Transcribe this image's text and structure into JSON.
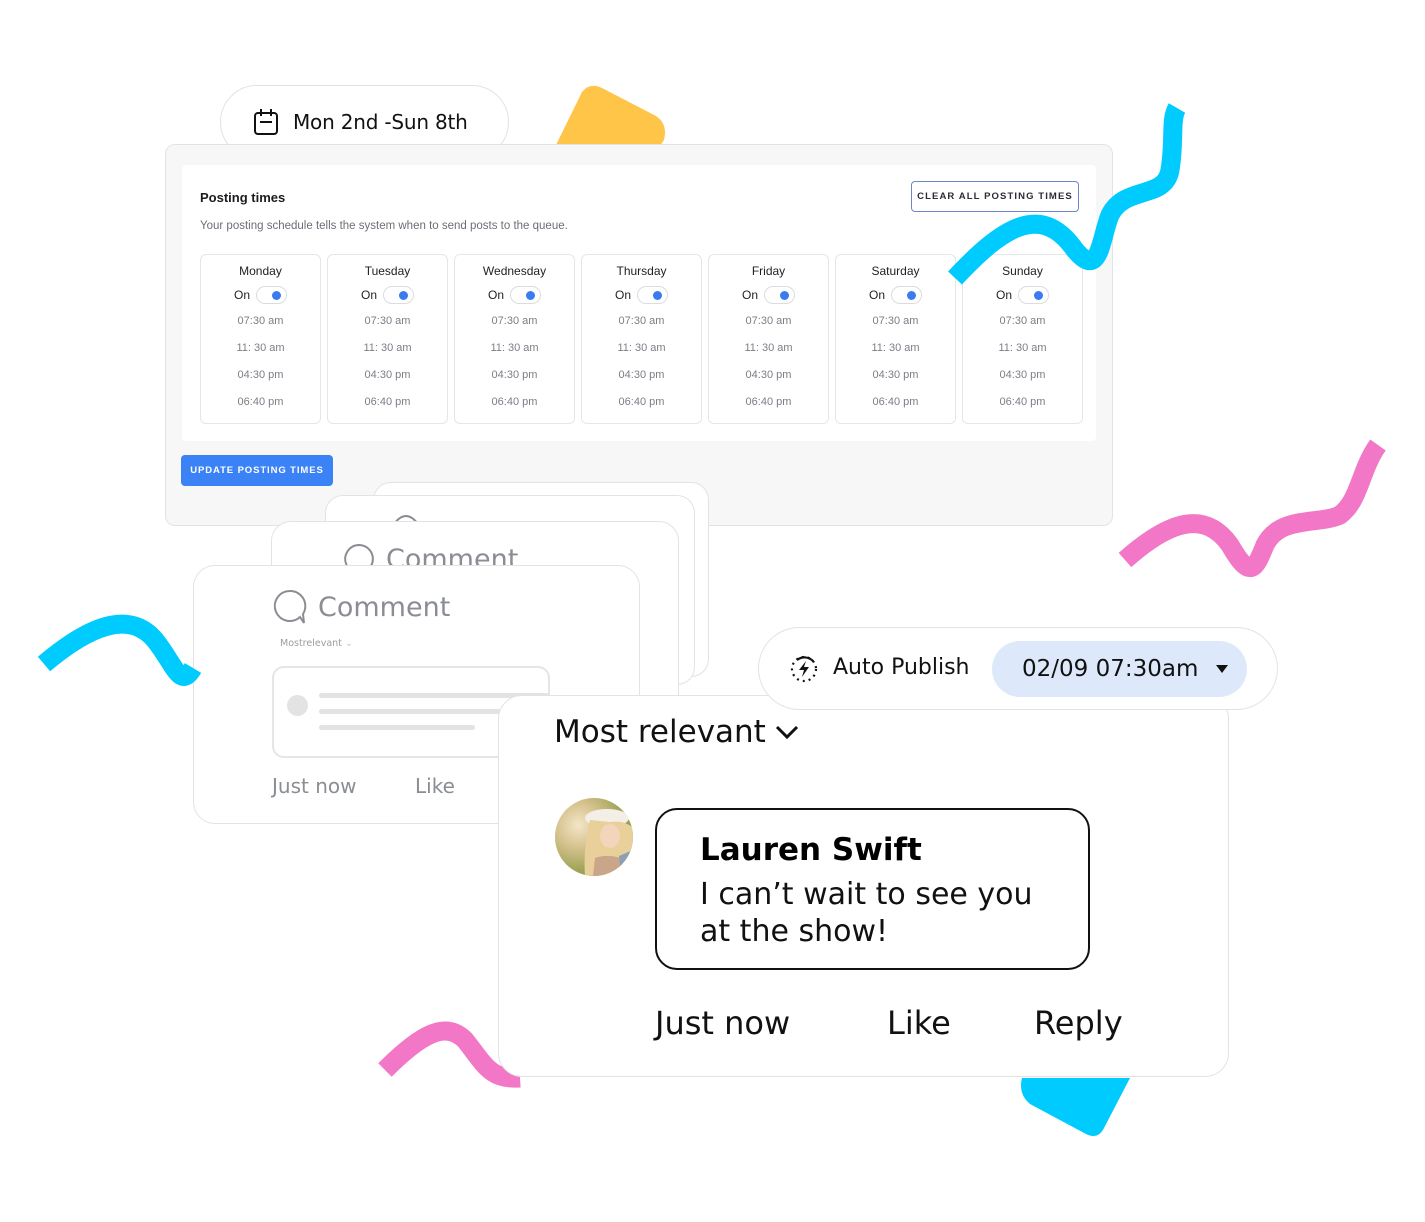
{
  "date_range": {
    "icon": "calendar-icon",
    "label": "Mon 2nd -Sun 8th"
  },
  "posting_times": {
    "title": "Posting times",
    "subtitle": "Your posting schedule tells the system when to send posts to the queue.",
    "clear_button": "CLEAR ALL POSTING TIMES",
    "update_button": "UPDATE POSTING TIMES",
    "toggle_on_color": "#3a7bf0",
    "days": [
      {
        "name": "Monday",
        "toggle_label": "On",
        "enabled": true,
        "times": [
          "07:30 am",
          "11: 30 am",
          "04:30 pm",
          "06:40 pm"
        ]
      },
      {
        "name": "Tuesday",
        "toggle_label": "On",
        "enabled": true,
        "times": [
          "07:30 am",
          "11: 30 am",
          "04:30 pm",
          "06:40 pm"
        ]
      },
      {
        "name": "Wednesday",
        "toggle_label": "On",
        "enabled": true,
        "times": [
          "07:30 am",
          "11: 30 am",
          "04:30 pm",
          "06:40 pm"
        ]
      },
      {
        "name": "Thursday",
        "toggle_label": "On",
        "enabled": true,
        "times": [
          "07:30 am",
          "11: 30 am",
          "04:30 pm",
          "06:40 pm"
        ]
      },
      {
        "name": "Friday",
        "toggle_label": "On",
        "enabled": true,
        "times": [
          "07:30 am",
          "11: 30 am",
          "04:30 pm",
          "06:40 pm"
        ]
      },
      {
        "name": "Saturday",
        "toggle_label": "On",
        "enabled": true,
        "times": [
          "07:30 am",
          "11: 30 am",
          "04:30 pm",
          "06:40 pm"
        ]
      },
      {
        "name": "Sunday",
        "toggle_label": "On",
        "enabled": true,
        "times": [
          "07:30 am",
          "11: 30 am",
          "04:30 pm",
          "06:40 pm"
        ]
      }
    ]
  },
  "ghost_cards": {
    "comment_label": "Comment",
    "sort_label": "Mostrelevant",
    "time_label": "Just now",
    "like_label": "Like"
  },
  "auto_publish": {
    "icon": "lightning-icon",
    "label": "Auto Publish",
    "datetime": "02/09 07:30am"
  },
  "comment": {
    "sort_label": "Most relevant",
    "author": "Lauren Swift",
    "text": "I can’t wait to see you at the show!",
    "time": "Just now",
    "like": "Like",
    "reply": "Reply"
  },
  "colors": {
    "accent_blue": "#3b82f6",
    "deco_cyan": "#00cbff",
    "deco_pink": "#f277c6",
    "deco_yellow": "#fec548",
    "pill_blue": "#dde9fb"
  }
}
